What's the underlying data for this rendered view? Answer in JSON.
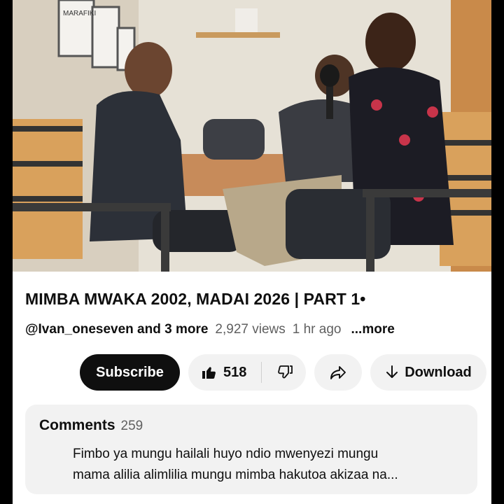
{
  "video": {
    "sign_text": "MARAFIKI"
  },
  "title": "MIMBA MWAKA 2002, MADAI 2026 | PART 1•",
  "meta": {
    "channel": "@Ivan_oneseven and 3 more",
    "views": "2,927 views",
    "age": "1 hr ago",
    "more": "...more"
  },
  "actions": {
    "subscribe": "Subscribe",
    "likes": "518",
    "download": "Download"
  },
  "comments": {
    "label": "Comments",
    "count": "259",
    "line1": "Fimbo ya mungu hailali huyo ndio mwenyezi mungu",
    "line2": "mama alilia alimlilia mungu mimba hakutoa akizaa na..."
  },
  "icons": {
    "like": "thumbs-up-icon",
    "dislike": "thumbs-down-icon",
    "share": "share-icon",
    "download": "download-arrow-icon"
  }
}
